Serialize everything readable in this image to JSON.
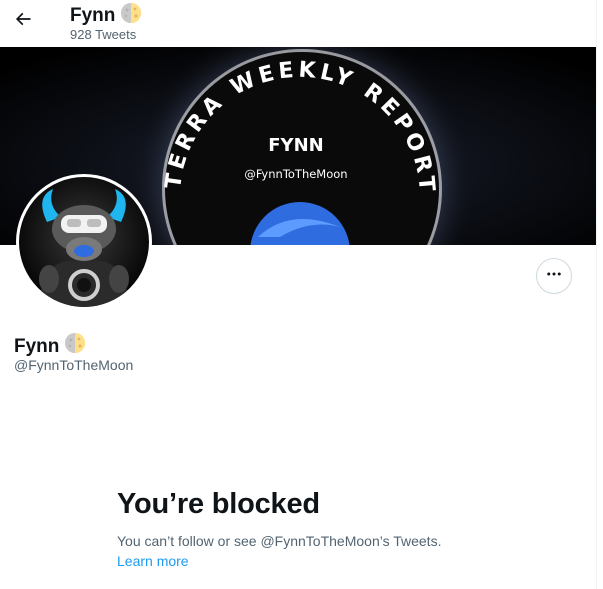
{
  "header": {
    "name": "Fynn",
    "tweet_count": "928 Tweets",
    "back_icon": "arrow-left-icon",
    "emoji_icon": "first-quarter-moon-icon"
  },
  "banner": {
    "arc_text": "TERRA WEEKLY REPORT",
    "center_name": "FYNN",
    "center_handle": "@FynnToTheMoon"
  },
  "profile": {
    "name": "Fynn",
    "handle": "@FynnToTheMoon",
    "more_icon": "more-horizontal-icon"
  },
  "blocked": {
    "title": "You’re blocked",
    "message": "You can’t follow or see @FynnToTheMoon’s Tweets.",
    "learn_more": "Learn more"
  },
  "colors": {
    "text_primary": "#0f1419",
    "text_secondary": "#536471",
    "link": "#1d9bf0",
    "border": "#cfd9de"
  }
}
